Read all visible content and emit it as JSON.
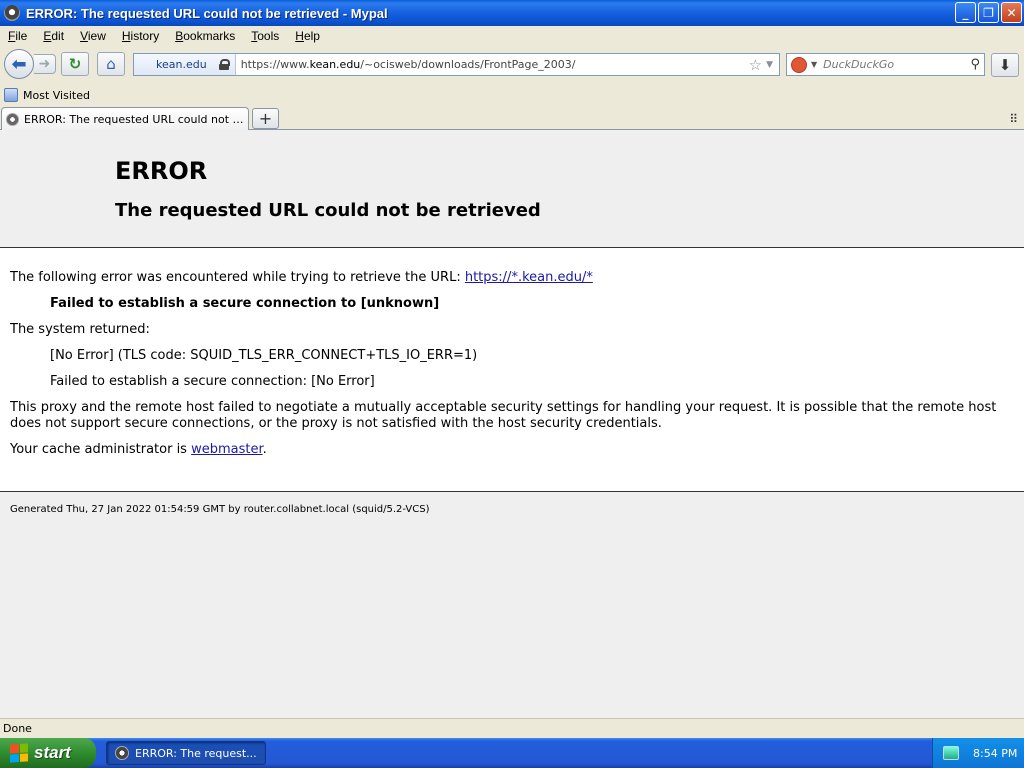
{
  "window": {
    "title": "ERROR: The requested URL could not be retrieved - Mypal"
  },
  "menu": [
    "File",
    "Edit",
    "View",
    "History",
    "Bookmarks",
    "Tools",
    "Help"
  ],
  "nav": {
    "identity_label": "kean.edu",
    "url_prefix": "https://www.",
    "url_domain": "kean.edu",
    "url_path": "/~ocisweb/downloads/FrontPage_2003/",
    "search_placeholder": "DuckDuckGo"
  },
  "bookmarks": {
    "most_visited": "Most Visited"
  },
  "tabs": [
    {
      "label": "ERROR: The requested URL could not be ret..."
    }
  ],
  "page": {
    "title": "ERROR",
    "subtitle": "The requested URL could not be retrieved",
    "intro_text": "The following error was encountered while trying to retrieve the URL: ",
    "intro_link": "https://*.kean.edu/*",
    "error_bold": "Failed to establish a secure connection to [unknown]",
    "system_returned": "The system returned:",
    "tls_code": "[No Error] (TLS code: SQUID_TLS_ERR_CONNECT+TLS_IO_ERR=1)",
    "failed_line": "Failed to establish a secure connection: [No Error]",
    "explanation": "This proxy and the remote host failed to negotiate a mutually acceptable security settings for handling your request. It is possible that the remote host does not support secure connections, or the proxy is not satisfied with the host security credentials.",
    "admin_prefix": "Your cache administrator is ",
    "admin_link": "webmaster",
    "admin_suffix": ".",
    "footer": "Generated Thu, 27 Jan 2022 01:54:59 GMT by router.collabnet.local (squid/5.2-VCS)"
  },
  "status": {
    "text": "Done"
  },
  "taskbar": {
    "start_label": "start",
    "task_label": "ERROR: The request...",
    "clock": "8:54 PM"
  },
  "colors": {
    "link": "#1a1aa6",
    "taskbar": "#245edb",
    "titlebar": "#1560de"
  }
}
